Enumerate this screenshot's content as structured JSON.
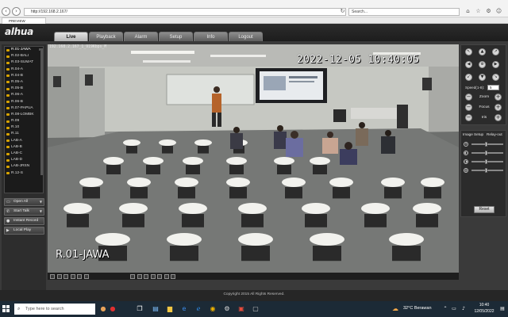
{
  "browser": {
    "url": "http://192.168.2.167/",
    "search_placeholder": "Search...",
    "tab_title": "PREVIEW"
  },
  "app": {
    "logo": "alhua",
    "tabs": [
      {
        "label": "Live",
        "active": true
      },
      {
        "label": "Playback",
        "active": false
      },
      {
        "label": "Alarm",
        "active": false
      },
      {
        "label": "Setup",
        "active": false
      },
      {
        "label": "Info",
        "active": false
      },
      {
        "label": "Logout",
        "active": false
      }
    ]
  },
  "sidebar": {
    "channels": [
      "R.01-JAWA",
      "R.02-BALI",
      "R.03-SUMAT",
      "R.04-A",
      "R.04-B",
      "R.05-A",
      "R.05-B",
      "R.06-A",
      "R.06-B",
      "R.07-PAPUA",
      "R.08-LOMBK",
      "R.09",
      "R.10",
      "R.11",
      "LAB-A",
      "LAB-B",
      "LAB-C",
      "LAB-D",
      "LAB-JRSN",
      "R.12-S"
    ],
    "selected_badge": "M",
    "buttons": {
      "open_all": "Open All",
      "start_talk": "Start Talk",
      "instant_record": "Instant Record",
      "local_play": "Local Play"
    }
  },
  "video": {
    "camera_info": "192.168.2.167_1_919Kbps_M",
    "osd_time": "2022-12-05 10:40:05",
    "osd_name": "R.01-JAWA"
  },
  "ptz": {
    "speed_label": "Speed(1-8):",
    "speed_value": "5",
    "zoom_label": "Zoom",
    "focus_label": "Focus",
    "iris_label": "Iris"
  },
  "image_setup": {
    "tab_image": "Image Setup",
    "tab_relay": "Relay-out",
    "reset_label": "Reset",
    "sliders": [
      0.45,
      0.45,
      0.45,
      0.45
    ]
  },
  "footer": {
    "copyright": "Copyright 2015 All Rights Reserved."
  },
  "taskbar": {
    "search_placeholder": "Type here to search",
    "weather": "32°C Berawan",
    "time": "10:40",
    "date": "12/05/2022"
  },
  "colors": {
    "app_bg": "#3a3a3a",
    "taskbar": "#1c2a36",
    "camera_marker": "#d9a400"
  }
}
